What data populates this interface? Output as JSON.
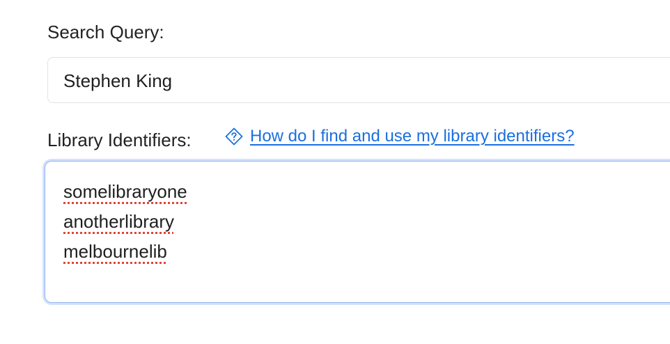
{
  "search": {
    "label": "Search Query:",
    "value": "Stephen King"
  },
  "library": {
    "label": "Library Identifiers:",
    "help_icon": "diamond-question-icon",
    "help_link": "How do I find and use my library identifiers?",
    "identifiers": [
      "somelibraryone",
      "anotherlibrary",
      "melbournelib"
    ]
  },
  "colors": {
    "link": "#1b6fe0",
    "focus_ring": "#8fb1f0",
    "spellcheck": "#e0443a"
  }
}
